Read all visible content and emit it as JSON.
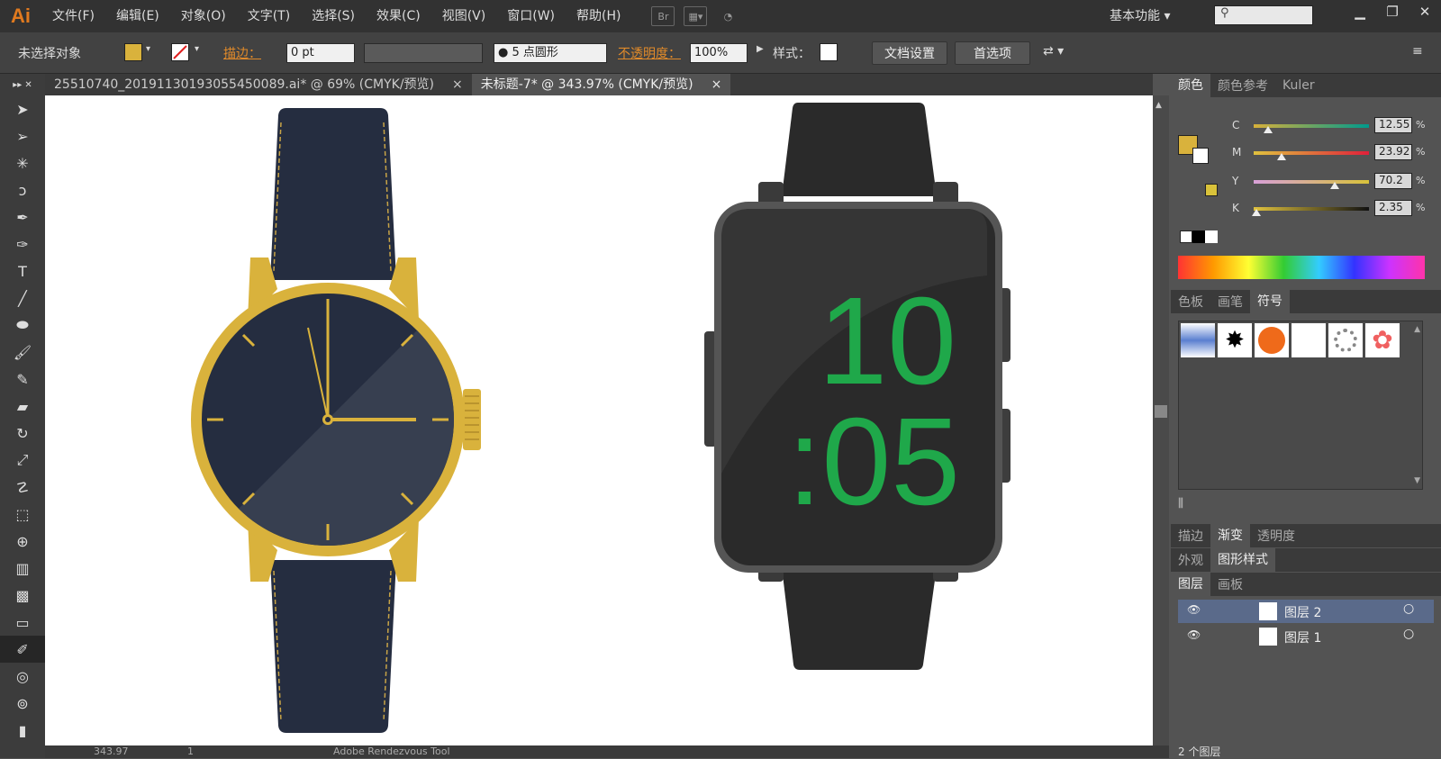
{
  "app": {
    "logo": "Ai"
  },
  "menu": [
    "文件(F)",
    "编辑(E)",
    "对象(O)",
    "文字(T)",
    "选择(S)",
    "效果(C)",
    "视图(V)",
    "窗口(W)",
    "帮助(H)"
  ],
  "menubar": {
    "bridge_label": "Br",
    "workspace": "基本功能"
  },
  "control": {
    "selection": "未选择对象",
    "fill_color": "#d9b23c",
    "stroke_label": "描边：",
    "stroke_weight": "0 pt",
    "brush": "5 点圆形",
    "opacity_label": "不透明度：",
    "opacity": "100%",
    "style_label": "样式：",
    "doc_setup": "文档设置",
    "prefs": "首选项"
  },
  "tabs": [
    {
      "title": "25510740_20191130193055450089.ai* @ 69% (CMYK/预览)",
      "close": "×"
    },
    {
      "title": "未标题-7* @ 343.97% (CMYK/预览)",
      "close": "×"
    }
  ],
  "canvas": {
    "digital_hour": "10",
    "digital_minute": ":05"
  },
  "color_panel": {
    "tabs": [
      "颜色",
      "颜色参考",
      "Kuler"
    ],
    "channels": [
      {
        "label": "C",
        "value": "12.55",
        "pct": "%",
        "level": 0.1255,
        "gradient": "linear-gradient(90deg,#d7b03a,#009a8c)"
      },
      {
        "label": "M",
        "value": "23.92",
        "pct": "%",
        "level": 0.2392,
        "gradient": "linear-gradient(90deg,#e0c23e,#e0203a)"
      },
      {
        "label": "Y",
        "value": "70.2",
        "pct": "%",
        "level": 0.702,
        "gradient": "linear-gradient(90deg,#d8a0d8,#d8c23a)"
      },
      {
        "label": "K",
        "value": "2.35",
        "pct": "%",
        "level": 0.0235,
        "gradient": "linear-gradient(90deg,#e0c23e,#111)"
      }
    ]
  },
  "swatch_panel": {
    "tabs": [
      "色板",
      "画笔",
      "符号"
    ]
  },
  "stroke_panel": {
    "tabs": [
      "描边",
      "渐变",
      "透明度"
    ]
  },
  "appearance_panel": {
    "tabs": [
      "外观",
      "图形样式"
    ]
  },
  "layers_panel": {
    "tabs": [
      "图层",
      "画板"
    ],
    "layers": [
      {
        "name": "图层 2"
      },
      {
        "name": "图层 1"
      }
    ],
    "count": "2 个图层"
  },
  "status": {
    "zoom": "343.97",
    "page": "1",
    "tool": "Adobe Rendezvous Tool"
  }
}
